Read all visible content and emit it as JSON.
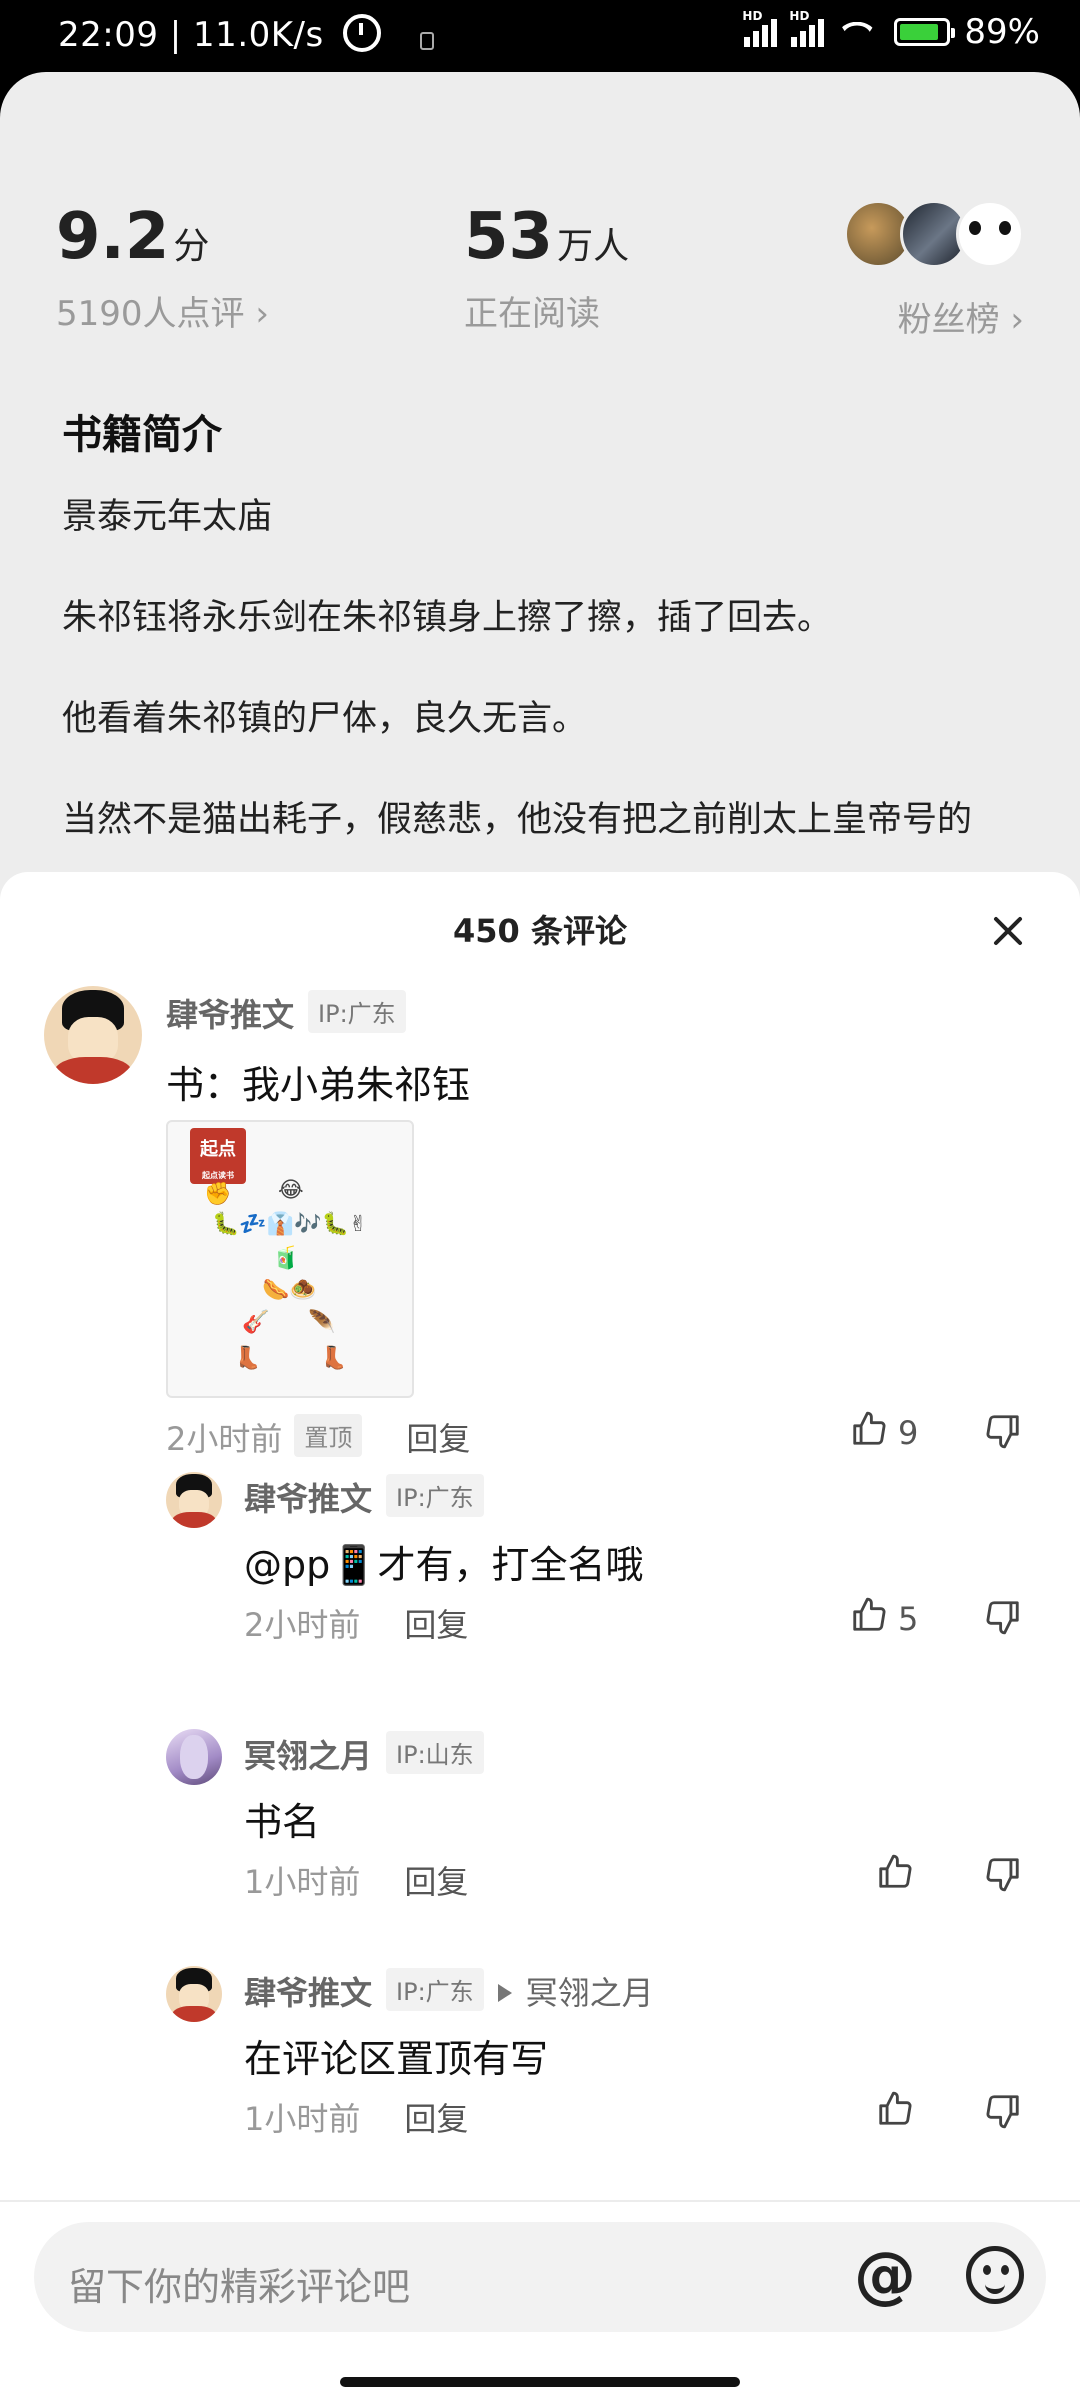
{
  "status_bar": {
    "time_speed": "22:09 | 11.0K/s",
    "signal1_label": "HD",
    "signal2_label": "HD",
    "battery": "89%"
  },
  "book": {
    "score": "9.2",
    "score_unit": "分",
    "ratings": "5190人点评 ›",
    "readers": "53",
    "readers_unit": "万人",
    "readers_label": "正在阅读",
    "fans_label": "粉丝榜 ›",
    "intro_title": "书籍简介",
    "intro_paragraphs": [
      "景泰元年太庙",
      "朱祁钰将永乐剑在朱祁镇身上擦了擦，插了回去。",
      "他看着朱祁镇的尸体，良久无言。",
      "当然不是猫出耗子，假慈悲，他没有把之前削太上皇帝号的"
    ]
  },
  "comments_sheet": {
    "title": "450 条评论",
    "main_comment": {
      "author": "肆爷推文",
      "ip": "IP:广东",
      "text": "书：我小弟朱祁钰",
      "sticker_logo": "起点",
      "sticker_logo_sub": "起点读书",
      "time": "2小时前",
      "pin_label": "置顶",
      "reply_label": "回复",
      "likes": "9"
    },
    "replies": [
      {
        "author": "肆爷推文",
        "ip": "IP:广东",
        "text": "@pp📱才有，打全名哦",
        "time": "2小时前",
        "reply_label": "回复",
        "likes": "5"
      },
      {
        "author": "冥翎之月",
        "ip": "IP:山东",
        "text": "书名",
        "time": "1小时前",
        "reply_label": "回复",
        "likes": ""
      },
      {
        "author": "肆爷推文",
        "ip": "IP:广东",
        "reply_to": "冥翎之月",
        "text": "在评论区置顶有写",
        "time": "1小时前",
        "reply_label": "回复",
        "likes": ""
      }
    ],
    "input_placeholder": "留下你的精彩评论吧",
    "at_symbol": "@"
  }
}
